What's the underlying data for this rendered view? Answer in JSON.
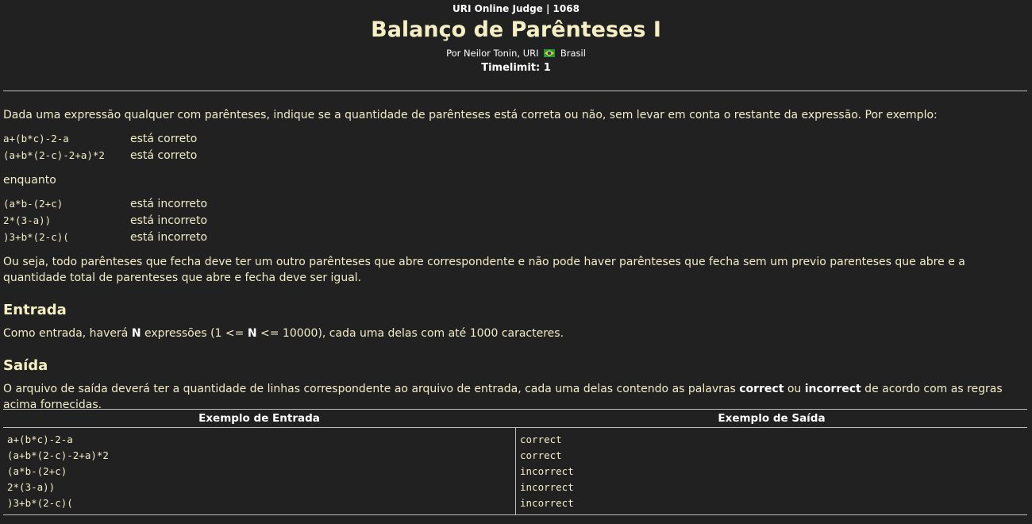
{
  "header": {
    "judge": "URI Online Judge | 1068",
    "title": "Balanço de Parênteses I",
    "author_prefix": "Por Neilor Tonin, URI",
    "author_country": "Brasil",
    "flag_icon": "brazil-flag-icon",
    "timelimit": "Timelimit: 1"
  },
  "description": {
    "intro": "Dada uma expressão qualquer com parênteses, indique se a quantidade de parênteses está correta ou não, sem levar em conta o restante da expressão. Por exemplo:",
    "correct_examples": [
      {
        "expr": "a+(b*c)-2-a",
        "result": "está correto"
      },
      {
        "expr": "(a+b*(2-c)-2+a)*2",
        "result": "está correto"
      }
    ],
    "while": "enquanto",
    "incorrect_examples": [
      {
        "expr": "(a*b-(2+c)",
        "result": "está incorreto"
      },
      {
        "expr": "2*(3-a))",
        "result": "está incorreto"
      },
      {
        "expr": ")3+b*(2-c)(",
        "result": "está incorreto"
      }
    ],
    "explanation": "Ou seja, todo parênteses que fecha deve ter um outro parênteses que abre correspondente e não pode haver parênteses que fecha sem um previo parenteses que abre e a quantidade total de parenteses que abre e fecha deve ser igual."
  },
  "input_section": {
    "heading": "Entrada",
    "text_1": "Como entrada, haverá ",
    "n1": "N",
    "text_2": " expressões (1 <= ",
    "n2": "N",
    "text_3": " <= 10000), cada uma delas com até 1000 caracteres."
  },
  "output_section": {
    "heading": "Saída",
    "text_1": "O arquivo de saída deverá ter a quantidade de linhas correspondente ao arquivo de entrada, cada uma delas contendo as palavras ",
    "word_correct": "correct",
    "text_2": " ou ",
    "word_incorrect": "incorrect",
    "text_3": " de acordo com as regras acima fornecidas."
  },
  "sample_table": {
    "input_header": "Exemplo de Entrada",
    "output_header": "Exemplo de Saída",
    "input_lines": [
      "a+(b*c)-2-a",
      "(a+b*(2-c)-2+a)*2",
      "(a*b-(2+c)",
      "2*(3-a))",
      ")3+b*(2-c)("
    ],
    "output_lines": [
      "correct",
      "correct",
      "incorrect",
      "incorrect",
      "incorrect"
    ]
  },
  "colors": {
    "background": "#212121",
    "text": "#f2ecc8",
    "rule": "#bdbdbd"
  }
}
